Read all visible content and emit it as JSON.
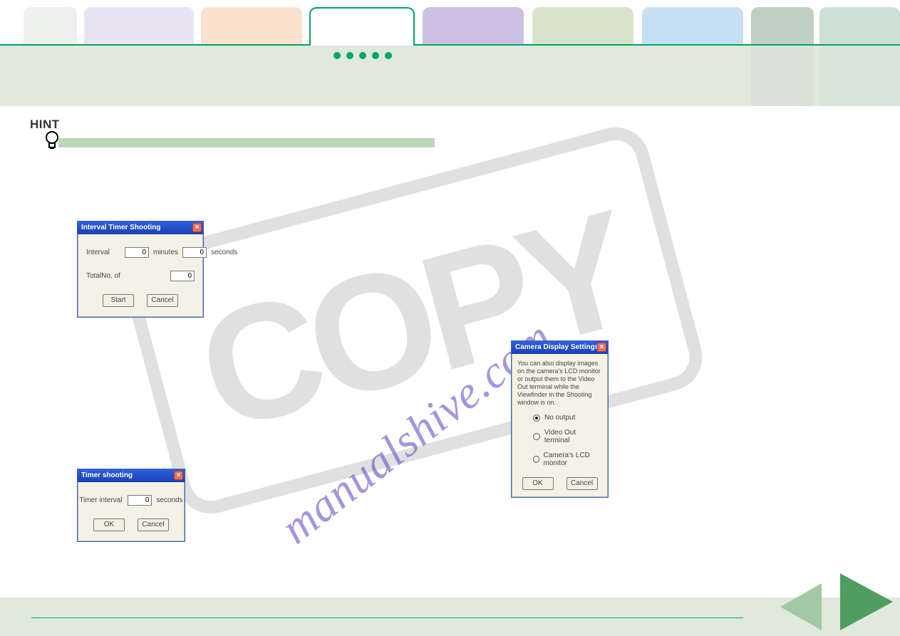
{
  "watermark": {
    "stamp": "COPY",
    "url": "manualshive.com"
  },
  "hint": {
    "label": "HINT"
  },
  "dialog_interval": {
    "title": "Interval Timer Shooting",
    "interval_label": "Interval",
    "minutes_value": "0",
    "minutes_unit": "minutes",
    "seconds_value": "0",
    "seconds_unit": "seconds",
    "total_label": "TotalNo. of",
    "total_value": "0",
    "start": "Start",
    "cancel": "Cancel"
  },
  "dialog_timer": {
    "title": "Timer shooting",
    "interval_label": "Timer interval",
    "seconds_value": "0",
    "seconds_unit": "seconds",
    "ok": "OK",
    "cancel": "Cancel"
  },
  "dialog_camdisp": {
    "title": "Camera Display Settings",
    "blurb": "You can also display images on the camera's LCD monitor or output them to the Video Out terminal while the Viewfinder in the Shooting window is on.",
    "opt1": "No output",
    "opt2": "Video Out terminal",
    "opt3": "Camera's LCD monitor",
    "ok": "OK",
    "cancel": "Cancel"
  },
  "icons": {
    "close": "×"
  }
}
